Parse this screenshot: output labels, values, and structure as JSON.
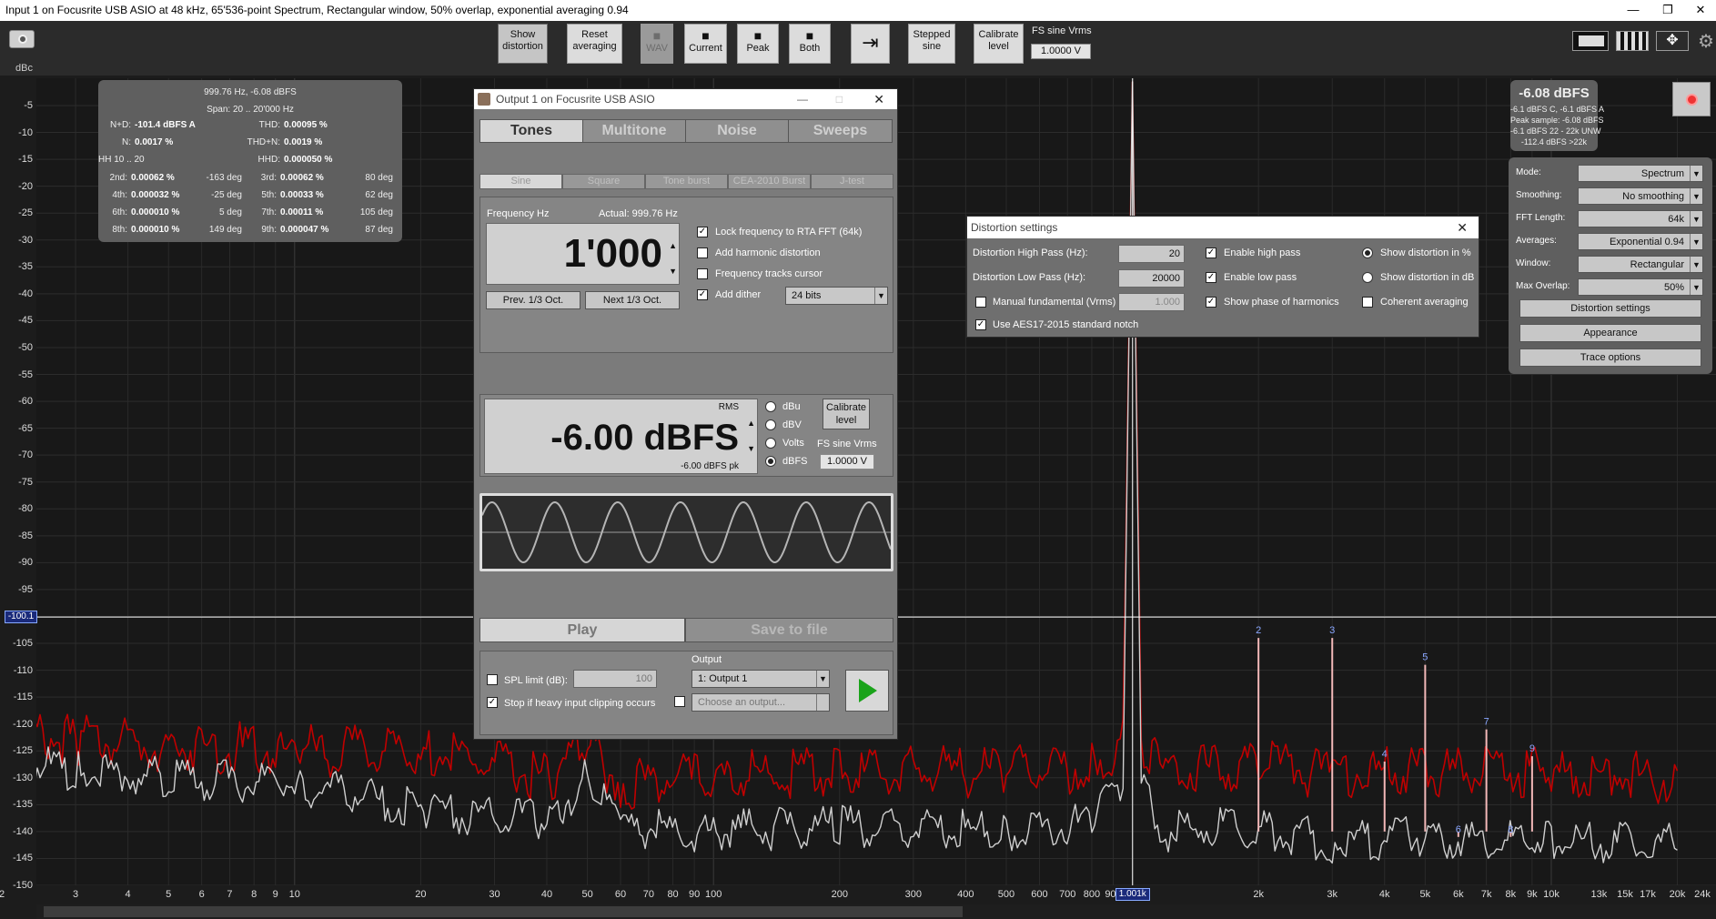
{
  "window": {
    "title": "Input 1 on Focusrite USB ASIO at 48 kHz, 65'536-point Spectrum, Rectangular window, 50% overlap, exponential averaging 0.94",
    "minimize": "—",
    "restore": "❐",
    "close": "✕"
  },
  "toolbar": {
    "show_distortion": "Show distortion",
    "reset_averaging": "Reset averaging",
    "wav": "WAV",
    "current": "Current",
    "peak": "Peak",
    "both": "Both",
    "stepped_sine": "Stepped sine",
    "calibrate_level": "Calibrate level",
    "fs_sine_label": "FS sine Vrms",
    "fs_sine_value": "1.0000 V"
  },
  "y_axis": {
    "unit": "dBc",
    "ticks": [
      "-5",
      "-10",
      "-15",
      "-20",
      "-25",
      "-30",
      "-35",
      "-40",
      "-45",
      "-50",
      "-55",
      "-60",
      "-65",
      "-70",
      "-75",
      "-80",
      "-85",
      "-90",
      "-95",
      "-100",
      "-105",
      "-110",
      "-115",
      "-120",
      "-125",
      "-130",
      "-135",
      "-140",
      "-145",
      "-150"
    ],
    "cursor_value": "-100.1"
  },
  "x_axis": {
    "ticks": [
      "2",
      "3",
      "4",
      "5",
      "6",
      "7",
      "8",
      "9",
      "10",
      "20",
      "30",
      "40",
      "50",
      "60",
      "70",
      "80",
      "90",
      "100",
      "200",
      "300",
      "400",
      "500",
      "600",
      "700",
      "800",
      "900",
      "2k",
      "3k",
      "4k",
      "5k",
      "6k",
      "7k",
      "8k",
      "9k",
      "10k",
      "13k",
      "15k",
      "17k",
      "20k",
      "24k"
    ],
    "cursor_value": "1.001k"
  },
  "chart_data": {
    "type": "line",
    "xlabel": "",
    "ylabel": "dBc",
    "x_scale": "log",
    "xlim": [
      2,
      24000
    ],
    "ylim": [
      -150,
      0
    ],
    "grid": true,
    "harmonic_markers": [
      {
        "label": "2",
        "freq": 2000,
        "dbc": -104
      },
      {
        "label": "3",
        "freq": 3000,
        "dbc": -104
      },
      {
        "label": "4",
        "freq": 4000,
        "dbc": -127
      },
      {
        "label": "5",
        "freq": 5000,
        "dbc": -109
      },
      {
        "label": "6",
        "freq": 6000,
        "dbc": -141
      },
      {
        "label": "7",
        "freq": 7000,
        "dbc": -121
      },
      {
        "label": "8",
        "freq": 8000,
        "dbc": -141
      },
      {
        "label": "9",
        "freq": 9000,
        "dbc": -126
      }
    ],
    "series": [
      {
        "color": "#c00000",
        "x": [
          2,
          3,
          5,
          10,
          20,
          40,
          50,
          60,
          100,
          200,
          500,
          800,
          950,
          1000,
          1050,
          1200,
          2000,
          3000,
          5000,
          10000,
          20000
        ],
        "y": [
          -122,
          -123,
          -124,
          -125,
          -125,
          -130,
          -124,
          -131,
          -130,
          -129,
          -129,
          -128,
          -123,
          -0.6,
          -123,
          -129,
          -128,
          -129,
          -129,
          -129,
          -130
        ]
      },
      {
        "color": "#cfcfcf",
        "x": [
          2,
          3,
          5,
          10,
          20,
          40,
          50,
          60,
          100,
          200,
          500,
          800,
          950,
          1000,
          1050,
          1200,
          2000,
          3000,
          5000,
          10000,
          20000
        ],
        "y": [
          -127,
          -129,
          -130,
          -131,
          -136,
          -138,
          -130,
          -139,
          -140,
          -139,
          -140,
          -138,
          -130,
          -0.6,
          -131,
          -140,
          -139,
          -142,
          -141,
          -142,
          -142
        ]
      }
    ]
  },
  "distortion_overlay": {
    "header": "999.76 Hz, -6.08 dBFS",
    "span": "Span: 20 .. 20'000 Hz",
    "rows": [
      {
        "l": "N+D:",
        "v": "-101.4 dBFS A",
        "l2": "THD:",
        "v2": "0.00095 %"
      },
      {
        "l": "N:",
        "v": "0.0017 %",
        "l2": "THD+N:",
        "v2": "0.0019 %"
      },
      {
        "l": "HH 10 .. 20",
        "v": "",
        "l2": "HHD:",
        "v2": "0.000050 %"
      }
    ],
    "harm": [
      {
        "a": "2nd:",
        "av": "0.00062 %",
        "ad": "-163 deg",
        "b": "3rd:",
        "bv": "0.00062 %",
        "bd": "80 deg"
      },
      {
        "a": "4th:",
        "av": "0.000032 %",
        "ad": "-25 deg",
        "b": "5th:",
        "bv": "0.00033 %",
        "bd": "62 deg"
      },
      {
        "a": "6th:",
        "av": "0.000010 %",
        "ad": "5 deg",
        "b": "7th:",
        "bv": "0.00011 %",
        "bd": "105 deg"
      },
      {
        "a": "8th:",
        "av": "0.000010 %",
        "ad": "149 deg",
        "b": "9th:",
        "bv": "0.000047 %",
        "bd": "87 deg"
      }
    ]
  },
  "level_overlay": {
    "main": "-6.08 dBFS",
    "l1": "-6.1 dBFS C, -6.1 dBFS A",
    "l2": "Peak sample: -6.08 dBFS",
    "l3": "-6.1 dBFS 22 - 22k UNW",
    "l4": "-112.4 dBFS >22k"
  },
  "settings": {
    "mode_label": "Mode:",
    "mode": "Spectrum",
    "smoothing_label": "Smoothing:",
    "smoothing": "No  smoothing",
    "fft_label": "FFT Length:",
    "fft": "64k",
    "avg_label": "Averages:",
    "avg": "Exponential 0.94",
    "window_label": "Window:",
    "window": "Rectangular",
    "overlap_label": "Max Overlap:",
    "overlap": "50%",
    "distortion_settings": "Distortion settings",
    "appearance": "Appearance",
    "trace_options": "Trace options"
  },
  "generator": {
    "title": "Output 1 on Focusrite USB ASIO",
    "tabs": [
      "Tones",
      "Multitone",
      "Noise",
      "Sweeps"
    ],
    "subtabs": [
      "Sine",
      "Square",
      "Tone burst",
      "CEA-2010 Burst",
      "J-test"
    ],
    "freq_label": "Frequency Hz",
    "actual": "Actual: 999.76 Hz",
    "freq": "1'000",
    "prev": "Prev. 1/3 Oct.",
    "next": "Next 1/3 Oct.",
    "lock": "Lock frequency to RTA FFT (64k)",
    "add_harm": "Add harmonic distortion",
    "tracks": "Frequency tracks cursor",
    "dither": "Add dither",
    "dither_bits": "24 bits",
    "rms": "RMS",
    "level": "-6.00 dBFS",
    "level_pk": "-6.00 dBFS pk",
    "dbu": "dBu",
    "dbv": "dBV",
    "volts": "Volts",
    "dbfs": "dBFS",
    "calibrate": "Calibrate level",
    "fs_label": "FS sine Vrms",
    "fs_value": "1.0000 V",
    "play": "Play",
    "save": "Save to file",
    "spl": "SPL limit (dB):",
    "spl_value": "100",
    "stop": "Stop if heavy input clipping occurs",
    "output_label": "Output",
    "output": "1: Output 1",
    "choose": "Choose an output..."
  },
  "distortion_dialog": {
    "title": "Distortion settings",
    "hp_label": "Distortion High Pass (Hz):",
    "hp": "20",
    "lp_label": "Distortion Low Pass (Hz):",
    "lp": "20000",
    "manual": "Manual fundamental (Vrms)",
    "manual_value": "1.000",
    "aes": "Use AES17-2015 standard notch",
    "enable_hp": "Enable high pass",
    "enable_lp": "Enable low pass",
    "show_phase": "Show phase of harmonics",
    "show_pct": "Show distortion in %",
    "show_db": "Show distortion in dB",
    "coherent": "Coherent averaging"
  }
}
